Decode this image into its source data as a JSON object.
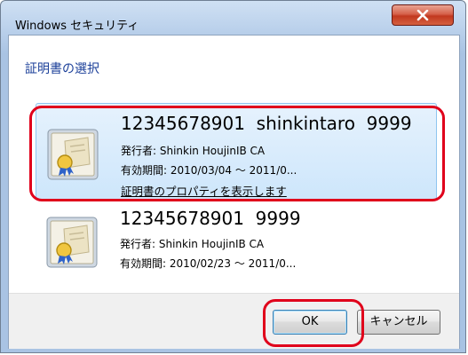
{
  "window": {
    "title": "Windows セキュリティ"
  },
  "dialog": {
    "subtitle": "証明書の選択",
    "certificates": [
      {
        "name": "12345678901  shinkintaro  9999",
        "issuer": "発行者: Shinkin HoujinIB CA",
        "validity": "有効期間: 2010/03/04 ～ 2011/0...",
        "properties_link": "証明書のプロパティを表示します",
        "selected": true
      },
      {
        "name": "12345678901  9999",
        "issuer": "発行者: Shinkin HoujinIB CA",
        "validity": "有効期間: 2010/02/23 ～ 2011/0...",
        "selected": false
      }
    ]
  },
  "buttons": {
    "ok": "OK",
    "cancel": "キャンセル"
  },
  "icons": {
    "close": "close-icon",
    "certificate": "certificate-icon"
  },
  "colors": {
    "highlight": "#e0001b",
    "title_blue": "#1b3f99",
    "close_red": "#c2381f"
  }
}
